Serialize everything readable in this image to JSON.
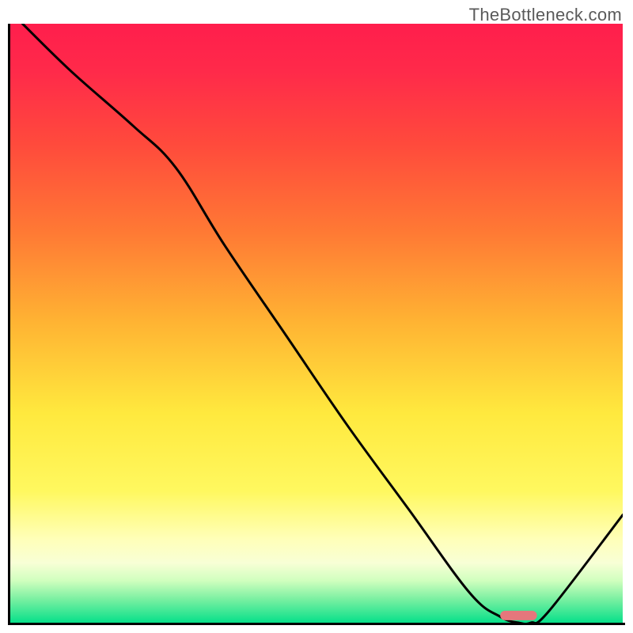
{
  "watermark": "TheBottleneck.com",
  "chart_data": {
    "type": "line",
    "title": "",
    "xlabel": "",
    "ylabel": "",
    "xlim": [
      0,
      100
    ],
    "ylim": [
      0,
      100
    ],
    "gradient_stops": [
      {
        "offset": 0.0,
        "color": "#ff1e4c"
      },
      {
        "offset": 0.08,
        "color": "#ff2a4a"
      },
      {
        "offset": 0.2,
        "color": "#ff4a3c"
      },
      {
        "offset": 0.35,
        "color": "#ff7a34"
      },
      {
        "offset": 0.5,
        "color": "#ffb433"
      },
      {
        "offset": 0.65,
        "color": "#ffe93e"
      },
      {
        "offset": 0.78,
        "color": "#fff85f"
      },
      {
        "offset": 0.86,
        "color": "#ffffb8"
      },
      {
        "offset": 0.9,
        "color": "#f8ffd6"
      },
      {
        "offset": 0.93,
        "color": "#d0ffbe"
      },
      {
        "offset": 0.96,
        "color": "#7cf0a2"
      },
      {
        "offset": 1.0,
        "color": "#07e08a"
      }
    ],
    "curve": {
      "x": [
        2,
        10,
        20,
        27,
        35,
        45,
        55,
        65,
        75,
        80,
        83,
        85,
        88,
        100
      ],
      "y": [
        100,
        92,
        83,
        76,
        63,
        48,
        33,
        19,
        5,
        1,
        0,
        0,
        2,
        18
      ]
    },
    "marker": {
      "x_start": 80,
      "x_end": 86,
      "y": 1.2,
      "color": "#e5777c"
    }
  }
}
